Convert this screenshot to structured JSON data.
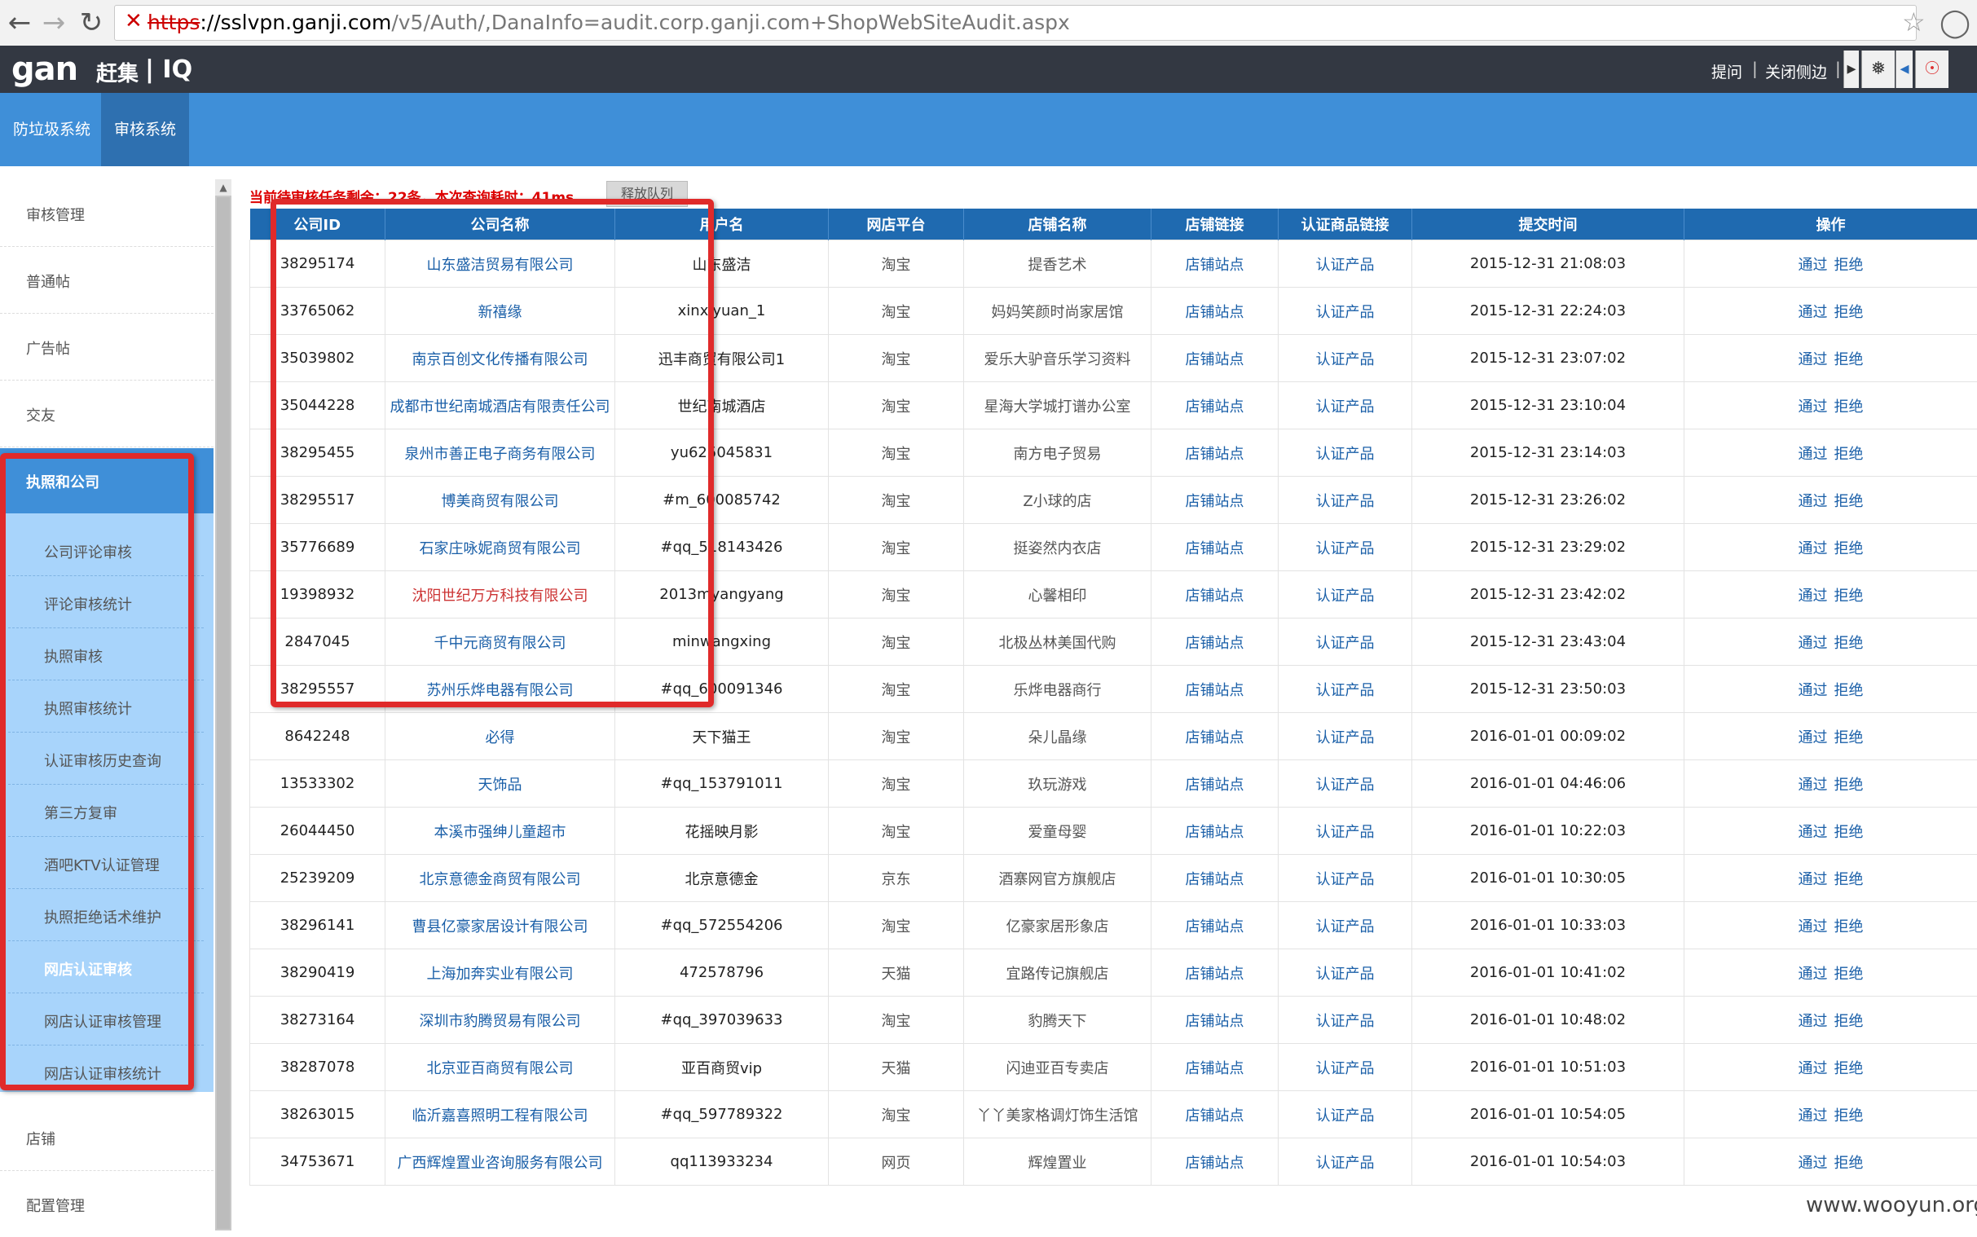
{
  "browser": {
    "url_proto": "https",
    "url_host": "://sslvpn.ganji.com",
    "url_path": "/v5/Auth/,DanaInfo=audit.corp.ganji.com+ShopWebSiteAudit.aspx",
    "back_icon": "back-arrow-icon",
    "forward_icon": "forward-arrow-icon",
    "reload_icon": "reload-icon",
    "security_icon": "insecure-x-icon",
    "star_icon": "star-icon",
    "menu_icon": "menu-icon"
  },
  "header": {
    "logo_text": "gan",
    "logo_cn": "赶集",
    "logo_iq": "| IQ",
    "link_ask": "提问",
    "link_close_sidebar": "关闭侧边",
    "separator": "|"
  },
  "nav": {
    "tabs": [
      {
        "label": "防垃圾系统"
      },
      {
        "label": "审核系统"
      }
    ]
  },
  "sidebar": {
    "items_top": [
      {
        "label": "审核管理"
      },
      {
        "label": "普通帖"
      },
      {
        "label": "广告帖"
      },
      {
        "label": "交友"
      }
    ],
    "group_title": "执照和公司",
    "sub_items": [
      {
        "label": "公司评论审核"
      },
      {
        "label": "评论审核统计"
      },
      {
        "label": "执照审核"
      },
      {
        "label": "执照审核统计"
      },
      {
        "label": "认证审核历史查询"
      },
      {
        "label": "第三方复审"
      },
      {
        "label": "酒吧KTV认证管理"
      },
      {
        "label": "执照拒绝话术维护"
      },
      {
        "label": "网店认证审核"
      },
      {
        "label": "网店认证审核管理"
      },
      {
        "label": "网店认证审核统计"
      }
    ],
    "items_bottom": [
      {
        "label": "店铺"
      },
      {
        "label": "配置管理"
      }
    ]
  },
  "main": {
    "status_text": "当前待审核任务剩余：22条，本次查询耗时：41ms",
    "release_button": "释放队列",
    "columns": [
      "公司ID",
      "公司名称",
      "用户名",
      "网店平台",
      "店铺名称",
      "店铺链接",
      "认证商品链接",
      "提交时间",
      "操作"
    ],
    "shop_link_label": "店铺站点",
    "product_link_label": "认证产品",
    "approve_label": "通过",
    "reject_label": "拒绝",
    "rows": [
      {
        "id": "38295174",
        "company": "山东盛洁贸易有限公司",
        "user": "山东盛洁",
        "platform": "淘宝",
        "shop": "提香艺术",
        "time": "2015-12-31 21:08:03"
      },
      {
        "id": "33765062",
        "company": "新禧缘",
        "user": "xinxiyuan_1",
        "platform": "淘宝",
        "shop": "妈妈笑颜时尚家居馆",
        "time": "2015-12-31 22:24:03"
      },
      {
        "id": "35039802",
        "company": "南京百创文化传播有限公司",
        "user": "迅丰商贸有限公司1",
        "platform": "淘宝",
        "shop": "爱乐大驴音乐学习资料",
        "time": "2015-12-31 23:07:02"
      },
      {
        "id": "35044228",
        "company": "成都市世纪南城酒店有限责任公司",
        "user": "世纪南城酒店",
        "platform": "淘宝",
        "shop": "星海大学城打谱办公室",
        "time": "2015-12-31 23:10:04"
      },
      {
        "id": "38295455",
        "company": "泉州市善正电子商务有限公司",
        "user": "yu625045831",
        "platform": "淘宝",
        "shop": "南方电子贸易",
        "time": "2015-12-31 23:14:03"
      },
      {
        "id": "38295517",
        "company": "博美商贸有限公司",
        "user": "#m_600085742",
        "platform": "淘宝",
        "shop": "Z小球的店",
        "time": "2015-12-31 23:26:02"
      },
      {
        "id": "35776689",
        "company": "石家庄咏妮商贸有限公司",
        "user": "#qq_518143426",
        "platform": "淘宝",
        "shop": "挺姿然内衣店",
        "time": "2015-12-31 23:29:02"
      },
      {
        "id": "19398932",
        "company": "沈阳世纪万方科技有限公司",
        "user": "2013myangyang",
        "platform": "淘宝",
        "shop": "心馨相印",
        "time": "2015-12-31 23:42:02",
        "red": true
      },
      {
        "id": "2847045",
        "company": "千中元商贸有限公司",
        "user": "minwangxing",
        "platform": "淘宝",
        "shop": "北极丛林美国代购",
        "time": "2015-12-31 23:43:04"
      },
      {
        "id": "38295557",
        "company": "苏州乐烨电器有限公司",
        "user": "#qq_600091346",
        "platform": "淘宝",
        "shop": "乐烨电器商行",
        "time": "2015-12-31 23:50:03"
      },
      {
        "id": "8642248",
        "company": "必得",
        "user": "天下猫王",
        "platform": "淘宝",
        "shop": "朵儿晶缘",
        "time": "2016-01-01 00:09:02"
      },
      {
        "id": "13533302",
        "company": "天饰品",
        "user": "#qq_153791011",
        "platform": "淘宝",
        "shop": "玖玩游戏",
        "time": "2016-01-01 04:46:06"
      },
      {
        "id": "26044450",
        "company": "本溪市强绅儿童超市",
        "user": "花摇映月影",
        "platform": "淘宝",
        "shop": "爱童母婴",
        "time": "2016-01-01 10:22:03"
      },
      {
        "id": "25239209",
        "company": "北京意德金商贸有限公司",
        "user": "北京意德金",
        "platform": "京东",
        "shop": "酒寨网官方旗舰店",
        "time": "2016-01-01 10:30:05"
      },
      {
        "id": "38296141",
        "company": "曹县亿豪家居设计有限公司",
        "user": "#qq_572554206",
        "platform": "淘宝",
        "shop": "亿豪家居形象店",
        "time": "2016-01-01 10:33:03"
      },
      {
        "id": "38290419",
        "company": "上海加奔实业有限公司",
        "user": "472578796",
        "platform": "天猫",
        "shop": "宜路传记旗舰店",
        "time": "2016-01-01 10:41:02"
      },
      {
        "id": "38273164",
        "company": "深圳市豹腾贸易有限公司",
        "user": "#qq_397039633",
        "platform": "淘宝",
        "shop": "豹腾天下",
        "time": "2016-01-01 10:48:02"
      },
      {
        "id": "38287078",
        "company": "北京亚百商贸有限公司",
        "user": "亚百商贸vip",
        "platform": "天猫",
        "shop": "闪迪亚百专卖店",
        "time": "2016-01-01 10:51:03"
      },
      {
        "id": "38263015",
        "company": "临沂嘉喜照明工程有限公司",
        "user": "#qq_597789322",
        "platform": "淘宝",
        "shop": "丫丫美家格调灯饰生活馆",
        "time": "2016-01-01 10:54:05"
      },
      {
        "id": "34753671",
        "company": "广西辉煌置业咨询服务有限公司",
        "user": "qq113933234",
        "platform": "网页",
        "shop": "辉煌置业",
        "time": "2016-01-01 10:54:03"
      }
    ]
  },
  "watermark": "www.wooyun.org",
  "colors": {
    "header_bg": "#333842",
    "nav_blue": "#3f8fd8",
    "table_header": "#1f6ab0",
    "sidebar_group": "#a8d4fb",
    "annotation_red": "#e02a2a",
    "status_red": "#dd0000"
  }
}
